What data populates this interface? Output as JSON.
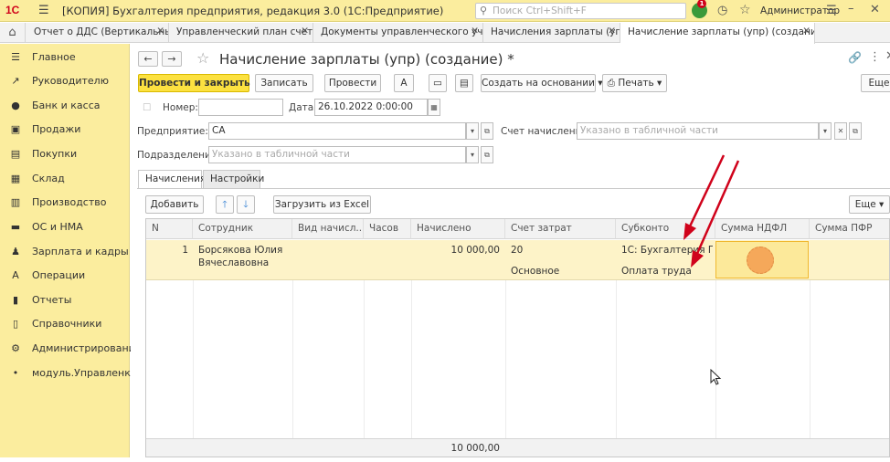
{
  "titlebar": {
    "logo": "1С",
    "title": "[КОПИЯ] Бухгалтерия предприятия, редакция 3.0  (1С:Предприятие)",
    "search_placeholder": "Поиск Ctrl+Shift+F",
    "notification_count": "1",
    "user": "Администратор"
  },
  "tabs": [
    {
      "label": "Отчет о ДДС (Вертикальный)"
    },
    {
      "label": "Управленческий план счетов"
    },
    {
      "label": "Документы управленческого учета"
    },
    {
      "label": "Начисления зарплаты (упр)"
    },
    {
      "label": "Начисление зарплаты (упр) (создание) *"
    }
  ],
  "sidebar": {
    "items": [
      {
        "label": "Главное",
        "icon": "menu-icon"
      },
      {
        "label": "Руководителю",
        "icon": "chart-line-icon"
      },
      {
        "label": "Банк и касса",
        "icon": "coin-icon"
      },
      {
        "label": "Продажи",
        "icon": "cart-icon"
      },
      {
        "label": "Покупки",
        "icon": "basket-icon"
      },
      {
        "label": "Склад",
        "icon": "warehouse-icon"
      },
      {
        "label": "Производство",
        "icon": "factory-icon"
      },
      {
        "label": "ОС и НМА",
        "icon": "truck-icon"
      },
      {
        "label": "Зарплата и кадры",
        "icon": "person-icon"
      },
      {
        "label": "Операции",
        "icon": "operations-icon"
      },
      {
        "label": "Отчеты",
        "icon": "report-icon"
      },
      {
        "label": "Справочники",
        "icon": "book-icon"
      },
      {
        "label": "Администрирование",
        "icon": "gear-icon"
      },
      {
        "label": "модуль.Управленка",
        "icon": "module-icon"
      }
    ]
  },
  "document": {
    "title": "Начисление зарплаты (упр) (создание) *",
    "toolbar": {
      "post_close": "Провести и закрыть",
      "save": "Записать",
      "post": "Провести",
      "create_based": "Создать на основании",
      "print": "Печать",
      "more": "Еще"
    },
    "number_label": "Номер:",
    "number_value": "",
    "date_label": "Дата:",
    "date_value": "26.10.2022  0:00:00",
    "company_label": "Предприятие:",
    "company_value": "СА",
    "account_label": "Счет начисления:",
    "account_placeholder": "Указано в табличной части",
    "department_label": "Подразделение:",
    "department_placeholder": "Указано в табличной части"
  },
  "form_tabs": [
    {
      "label": "Начисления"
    },
    {
      "label": "Настройки"
    }
  ],
  "table_toolbar": {
    "add": "Добавить",
    "load_excel": "Загрузить из Excel",
    "more": "Еще"
  },
  "table": {
    "columns": [
      "N",
      "Сотрудник",
      "Вид начисл...",
      "Часов",
      "Начислено",
      "Счет затрат",
      "Субконто",
      "Сумма НДФЛ",
      "Сумма ПФР"
    ],
    "rows": [
      {
        "n": "1",
        "employee_line1": "Борсякова Юлия",
        "employee_line2": "Вячеславовна",
        "kind": "",
        "hours": "",
        "accrued": "10 000,00",
        "account": "20",
        "account_sub": "Основное",
        "subconto1": "1С: Бухгалтерия П...",
        "subconto2": "Оплата труда",
        "ndfl": "",
        "pfr": ""
      }
    ],
    "total_accrued": "10 000,00"
  },
  "annotation_color": "#d0021b"
}
